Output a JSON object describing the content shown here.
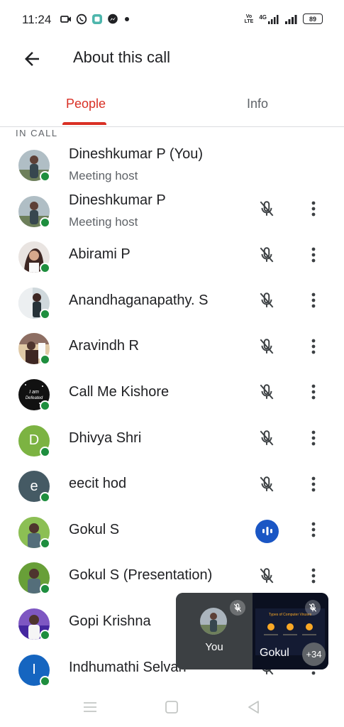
{
  "status_bar": {
    "time": "11:24",
    "left_icons": [
      "video-camera-icon",
      "whatsapp-icon",
      "app-icon",
      "messenger-icon",
      "dot-icon"
    ],
    "right_icons": [
      "volte-icon",
      "4g-signal-icon",
      "signal-icon",
      "battery-icon"
    ],
    "volte_top": "Vo",
    "volte_bottom": "LTE",
    "network": "4G",
    "battery": "89"
  },
  "app_bar": {
    "title": "About this call",
    "back_icon": "arrow-back-icon"
  },
  "tabs": [
    {
      "label": "People",
      "selected": true
    },
    {
      "label": "Info",
      "selected": false
    }
  ],
  "colors": {
    "accent": "#d93025",
    "online": "#1e8e3e",
    "speaking": "#1a56c4",
    "muted_icon": "#3c4043"
  },
  "section_label": "IN CALL",
  "participants": [
    {
      "name": "Dineshkumar P (You)",
      "subtitle": "Meeting host",
      "avatar": "photo",
      "mic": "none"
    },
    {
      "name": "Dineshkumar P",
      "subtitle": "Meeting host",
      "avatar": "photo",
      "mic": "muted"
    },
    {
      "name": "Abirami P",
      "subtitle": "",
      "avatar": "photo",
      "mic": "muted"
    },
    {
      "name": "Anandhaganapathy. S",
      "subtitle": "",
      "avatar": "photo",
      "mic": "muted"
    },
    {
      "name": "Aravindh R",
      "subtitle": "",
      "avatar": "photo",
      "mic": "muted"
    },
    {
      "name": "Call Me Kishore",
      "subtitle": "",
      "avatar": "photo",
      "mic": "muted"
    },
    {
      "name": "Dhivya Shri",
      "subtitle": "",
      "avatar": "initial",
      "initial": "D",
      "avatar_color": "#7cb342",
      "mic": "muted"
    },
    {
      "name": "eecit hod",
      "subtitle": "",
      "avatar": "initial",
      "initial": "e",
      "avatar_color": "#455a64",
      "mic": "muted"
    },
    {
      "name": "Gokul S",
      "subtitle": "",
      "avatar": "photo",
      "mic": "speaking"
    },
    {
      "name": "Gokul S (Presentation)",
      "subtitle": "",
      "avatar": "photo",
      "mic": "muted"
    },
    {
      "name": "Gopi Krishna",
      "subtitle": "",
      "avatar": "photo",
      "mic": "muted"
    },
    {
      "name": "Indhumathi Selvan",
      "subtitle": "",
      "avatar": "initial",
      "initial": "I",
      "avatar_color": "#1565c0",
      "mic": "muted"
    }
  ],
  "pip": {
    "self_label": "You",
    "other_label": "Gokul",
    "more_count": "+34",
    "slide_title": "Types of Computer Viruses"
  },
  "nav_bar": {
    "icons": [
      "recents-icon",
      "home-icon",
      "back-icon"
    ]
  }
}
